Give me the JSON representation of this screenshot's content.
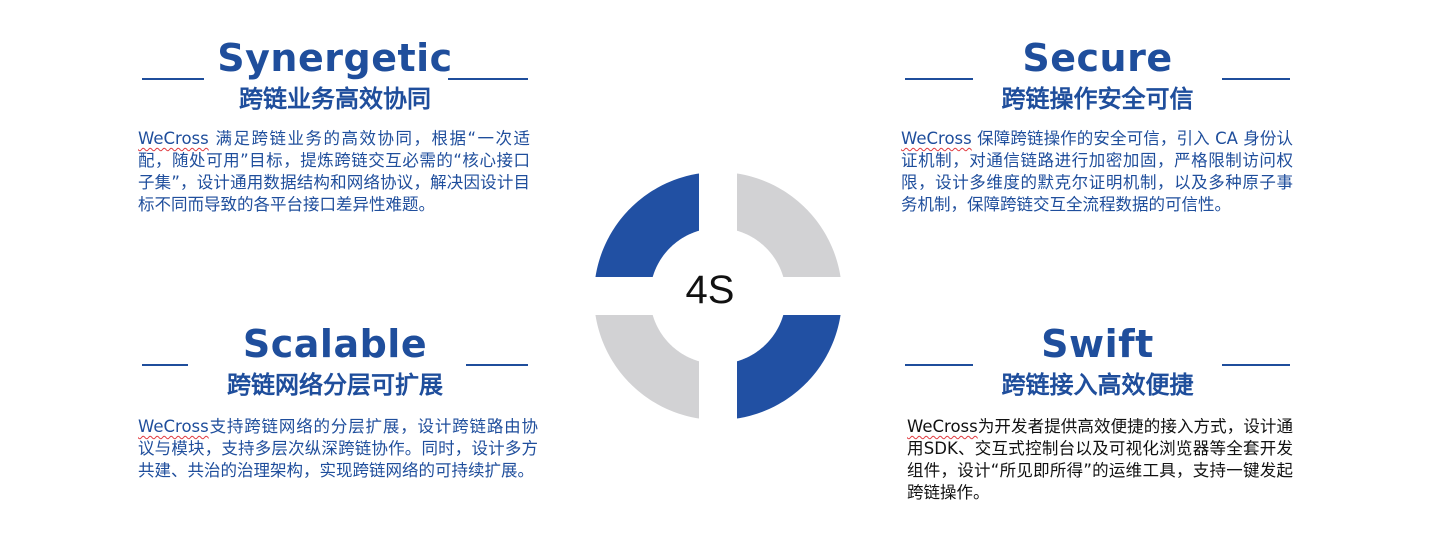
{
  "center_label": "4S",
  "colors": {
    "accent": "#1f4e9c",
    "segment_blue": "#2150a3",
    "segment_gray": "#d2d2d4",
    "brand_underline": "#e0393e"
  },
  "quadrants": {
    "synergetic": {
      "title_en": "Synergetic",
      "title_cn": "跨链业务高效协同",
      "brand": "WeCross",
      "desc": " 满足跨链业务的高效协同，根据“一次适配，随处可用”目标，提炼跨链交互必需的“核心接口子集”，设计通用数据结构和网络协议，解决因设计目标不同而导致的各平台接口差异性难题。"
    },
    "secure": {
      "title_en": "Secure",
      "title_cn": "跨链操作安全可信",
      "brand": "WeCross",
      "desc": " 保障跨链操作的安全可信，引入 CA 身份认证机制，对通信链路进行加密加固，严格限制访问权限，设计多维度的默克尔证明机制，以及多种原子事务机制，保障跨链交互全流程数据的可信性。"
    },
    "scalable": {
      "title_en": "Scalable",
      "title_cn": "跨链网络分层可扩展",
      "brand": "WeCross",
      "desc": "支持跨链网络的分层扩展，设计跨链路由协议与模块，支持多层次纵深跨链协作。同时，设计多方共建、共治的治理架构，实现跨链网络的可持续扩展。"
    },
    "swift": {
      "title_en": "Swift",
      "title_cn": "跨链接入高效便捷",
      "brand": "WeCross",
      "desc": "为开发者提供高效便捷的接入方式，设计通用SDK、交互式控制台以及可视化浏览器等全套开发组件，设计“所见即所得”的运维工具，支持一键发起跨链操作。"
    }
  }
}
